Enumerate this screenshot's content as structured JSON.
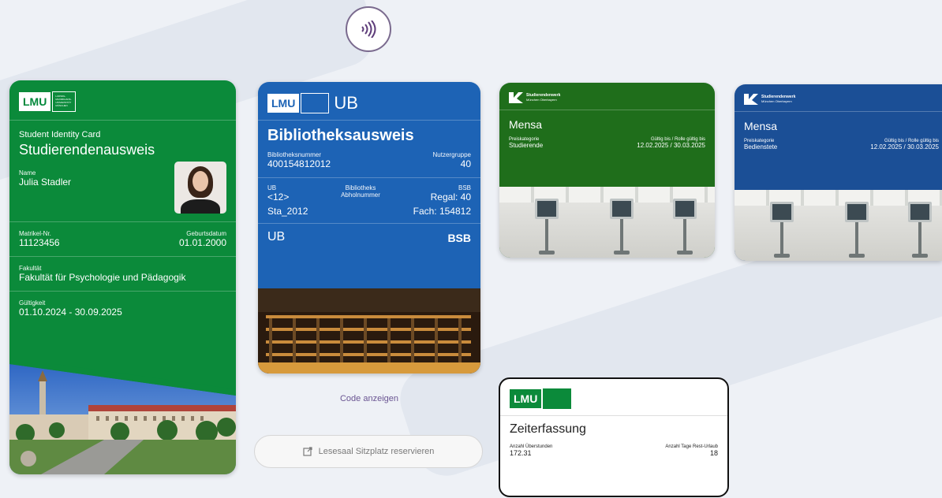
{
  "student_card": {
    "logo_text": "LMU",
    "logo_sub": "LUDWIG-MAXIMILIANS-UNIVERSITÄT MÜNCHEN",
    "subtitle": "Student Identity Card",
    "title": "Studierendenausweis",
    "name_label": "Name",
    "name_value": "Julia Stadler",
    "matrikel_label": "Matrikel-Nr.",
    "matrikel_value": "11123456",
    "birth_label": "Geburtsdatum",
    "birth_value": "01.01.2000",
    "faculty_label": "Fakultät",
    "faculty_value": "Fakultät für Psychologie und Pädagogik",
    "validity_label": "Gültigkeit",
    "validity_value": "01.10.2024 - 30.09.2025"
  },
  "library_card": {
    "logo_text": "LMU",
    "ub_text": "UB",
    "title": "Bibliotheksausweis",
    "number_label": "Bibliotheksnummer",
    "number_value": "400154812012",
    "group_label": "Nutzergruppe",
    "group_value": "40",
    "ub_label": "UB",
    "ub_value1": "<12>",
    "ub_value2": "Sta_2012",
    "pickup_label": "Bibliotheks Abholnummer",
    "bsb_label": "BSB",
    "bsb_value1": "Regal: 40",
    "bsb_value2": "Fach: 154812",
    "footer_left": "UB",
    "footer_right": "BSB"
  },
  "code_button": "Code anzeigen",
  "reserve_button": "Lesesaal Sitzplatz reservieren",
  "mensa_cards": [
    {
      "org": "Studierendenwerk",
      "org_sub": "München Oberbayern",
      "title": "Mensa",
      "category_label": "Preiskategorie",
      "category_value": "Studierende",
      "valid_label": "Gültig bis / Rolle gültig bis",
      "valid_value": "12.02.2025 / 30.03.2025",
      "color": "#1f6e1b"
    },
    {
      "org": "Studierendenwerk",
      "org_sub": "München Oberbayern",
      "title": "Mensa",
      "category_label": "Preiskategorie",
      "category_value": "Bedienstete",
      "valid_label": "Gültig bis / Rolle gültig bis",
      "valid_value": "12.02.2025 / 30.03.2025",
      "color": "#1b4f96"
    }
  ],
  "zeit_card": {
    "logo_text": "LMU",
    "title": "Zeiterfassung",
    "overtime_label": "Anzahl Überstunden",
    "overtime_value": "172.31",
    "vacation_label": "Anzahl Tage Rest-Urlaub",
    "vacation_value": "18"
  },
  "icons": [
    "nfc-icon",
    "external-link-icon",
    "lmu-logo-icon",
    "studierendenwerk-logo-icon"
  ]
}
